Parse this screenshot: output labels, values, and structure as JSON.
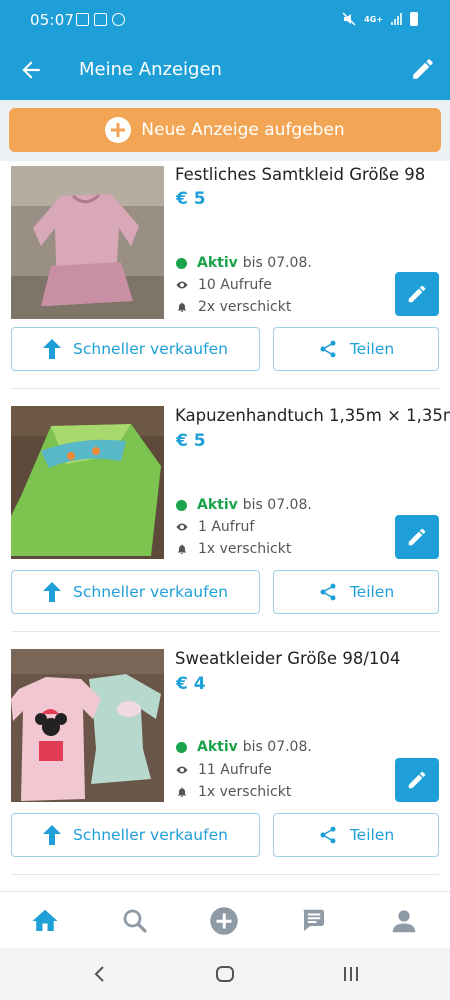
{
  "status_bar": {
    "time": "05:07",
    "network": "4G+"
  },
  "app_bar": {
    "title": "Meine Anzeigen"
  },
  "new_ad": {
    "label": "Neue Anzeige aufgeben"
  },
  "ads": [
    {
      "title": "Festliches Samtkleid Größe 98",
      "price": "€ 5",
      "status_label": "Aktiv",
      "status_until": "bis 07.08.",
      "views": "10 Aufrufe",
      "sent": "2x verschickt",
      "sell_label": "Schneller verkaufen",
      "share_label": "Teilen"
    },
    {
      "title": "Kapuzenhandtuch 1,35m × 1,35m",
      "price": "€ 5",
      "status_label": "Aktiv",
      "status_until": "bis 07.08.",
      "views": "1 Aufruf",
      "sent": "1x verschickt",
      "sell_label": "Schneller verkaufen",
      "share_label": "Teilen"
    },
    {
      "title": "Sweatkleider Größe 98/104",
      "price": "€ 4",
      "status_label": "Aktiv",
      "status_until": "bis 07.08.",
      "views": "11 Aufrufe",
      "sent": "1x verschickt",
      "sell_label": "Schneller verkaufen",
      "share_label": "Teilen"
    }
  ],
  "bottom_nav": [
    "home-icon",
    "search-icon",
    "add-circle-icon",
    "messages-icon",
    "profile-icon"
  ],
  "colors": {
    "primary": "#1f9fd8",
    "accent": "#f2a655",
    "active": "#1aa34a"
  }
}
